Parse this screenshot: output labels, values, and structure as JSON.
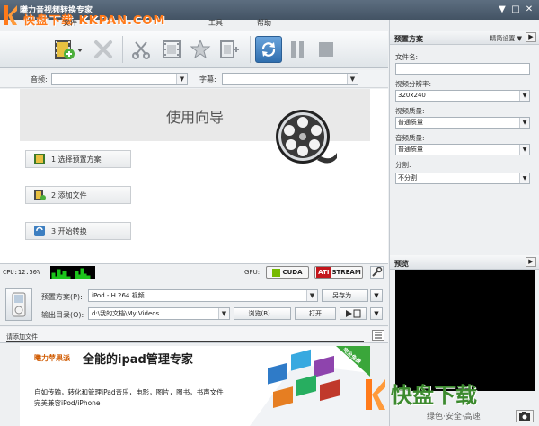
{
  "window": {
    "title": "曦力音视频转换专家",
    "watermark": "快盘下载 KKPAN.COM",
    "minimize": "▼",
    "restore": "□",
    "close": "✕"
  },
  "menu": [
    "文件",
    "编辑",
    "工具",
    "帮助"
  ],
  "toolbar": {
    "buttons": [
      "add-file",
      "delete",
      "cut",
      "clip",
      "effect",
      "merge",
      "convert",
      "pause",
      "stop"
    ]
  },
  "av": {
    "audio_label": "音频:",
    "audio_value": "",
    "subtitle_label": "字幕:",
    "subtitle_value": ""
  },
  "wizard": {
    "title": "使用向导",
    "steps": [
      "1.选择预置方案",
      "2.添加文件",
      "3.开始转换"
    ]
  },
  "status": {
    "cpu": "CPU:12.50%",
    "gpu_label": "GPU:",
    "cuda": "CUDA",
    "ati": "STREAM"
  },
  "output": {
    "preset_label": "预置方案(P):",
    "preset_value": "iPod - H.264 视频",
    "save_as": "另存为...",
    "dir_label": "输出目录(O):",
    "dir_value": "d:\\我的文档\\My Videos",
    "browse": "浏览(B)...",
    "open": "打开"
  },
  "filebar": {
    "label": "请添加文件"
  },
  "ad": {
    "brand": "曦力苹果派",
    "headline": "全能的ipad管理专家",
    "line1": "自如传输，转化和管理iPad音乐，电影，图片，图书，书声文件",
    "line2": "完美兼容iPod/iPhone",
    "ribbon": "完全免费"
  },
  "right": {
    "preset_header": "预置方案",
    "advanced": "精简设置 ▼",
    "filename_label": "文件名:",
    "filename_value": "",
    "resolution_label": "视频分辨率:",
    "resolution_value": "320x240",
    "vq_label": "视频质量:",
    "vq_value": "普通质量",
    "aq_label": "音频质量:",
    "aq_value": "普通质量",
    "split_label": "分割:",
    "split_value": "不分割",
    "preview_header": "预览"
  },
  "watermark2": {
    "big": "快盘下载",
    "small": "绿色·安全·高速"
  },
  "colors": {
    "titlebar": "#4a5a6b",
    "accent": "#ff7a1a",
    "convert_blue": "#3d7fc1"
  }
}
